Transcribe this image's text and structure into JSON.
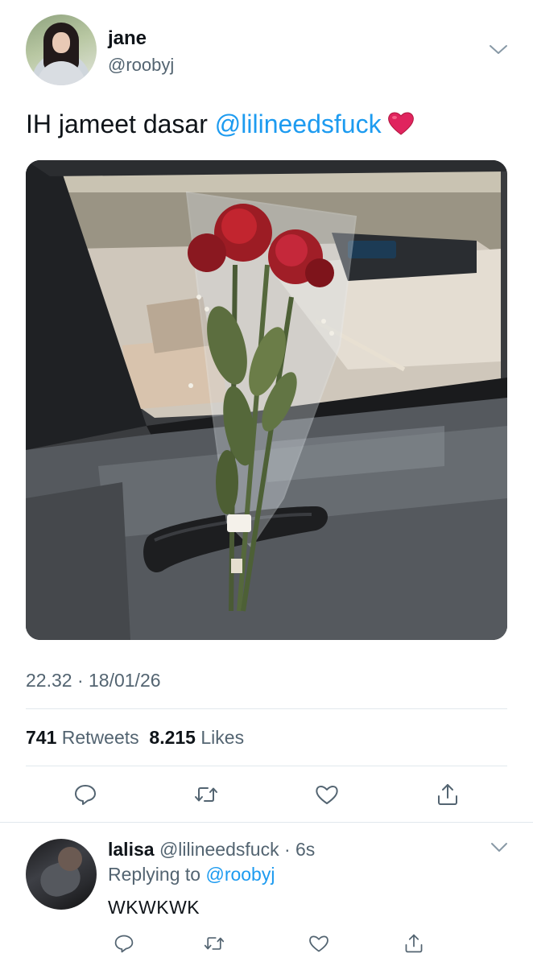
{
  "tweet": {
    "author": {
      "display_name": "jane",
      "handle": "@roobyj"
    },
    "text_prefix": "IH jameet dasar ",
    "text_mention": "@lilineedsfuck",
    "emoji": "red-heart-emoji",
    "timestamp": "22.32 · 18/01/26",
    "stats": {
      "retweets_count": "741",
      "retweets_label": "Retweets",
      "likes_count": "8.215",
      "likes_label": "Likes"
    },
    "actions": [
      "reply-icon",
      "retweet-icon",
      "like-icon",
      "share-icon"
    ]
  },
  "reply": {
    "author": {
      "display_name": "lalisa",
      "handle_time": "@lilineedsfuck · 6s"
    },
    "replying_prefix": "Replying to ",
    "replying_mention": "@roobyj",
    "text": "WKWKWK",
    "actions": [
      "reply-icon",
      "retweet-icon",
      "like-icon",
      "share-icon"
    ]
  },
  "colors": {
    "text": "#0f1419",
    "secondary": "#536471",
    "link": "#1d9bf0",
    "divider": "#e1e8ed",
    "heart": "#e0245e"
  }
}
